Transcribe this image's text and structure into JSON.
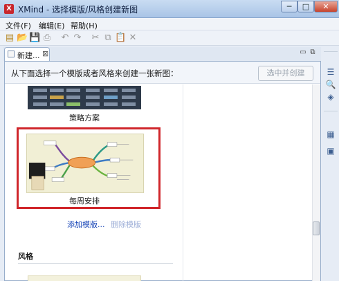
{
  "window": {
    "title": "XMind - 选择模版/风格创建新图",
    "app_icon": "X",
    "controls": {
      "minimize": "─",
      "maximize": "□",
      "close": "✕"
    }
  },
  "menu": [
    {
      "label": "文件(F)"
    },
    {
      "label": "编辑(E)"
    },
    {
      "label": "帮助(H)"
    }
  ],
  "toolbar": {
    "icons": [
      "new-icon",
      "open-icon",
      "save-icon",
      "print-icon",
      "undo-icon",
      "redo-icon",
      "cut-icon",
      "copy-icon",
      "paste-icon",
      "delete-icon"
    ],
    "glyphs": [
      "▤",
      "📂",
      "💾",
      "⎙",
      "↶",
      "↷",
      "✂",
      "⧉",
      "📋",
      "✕"
    ]
  },
  "tab": {
    "label": "新建...",
    "close": "⊠"
  },
  "view_controls": {
    "minimize": "▭",
    "maximize": "⧉"
  },
  "main": {
    "prompt": "从下面选择一个模版或者风格来创建一张新图：",
    "create_button": "选中并创建",
    "templates": [
      {
        "label": "策略方案"
      },
      {
        "label": "每周安排"
      }
    ],
    "add_template": "添加模版...",
    "delete_template": "删除模版",
    "styles_heading": "风格"
  },
  "colors": {
    "selection_border": "#d0262b",
    "link": "#1a47b8",
    "link_disabled": "#9fb0d8"
  }
}
